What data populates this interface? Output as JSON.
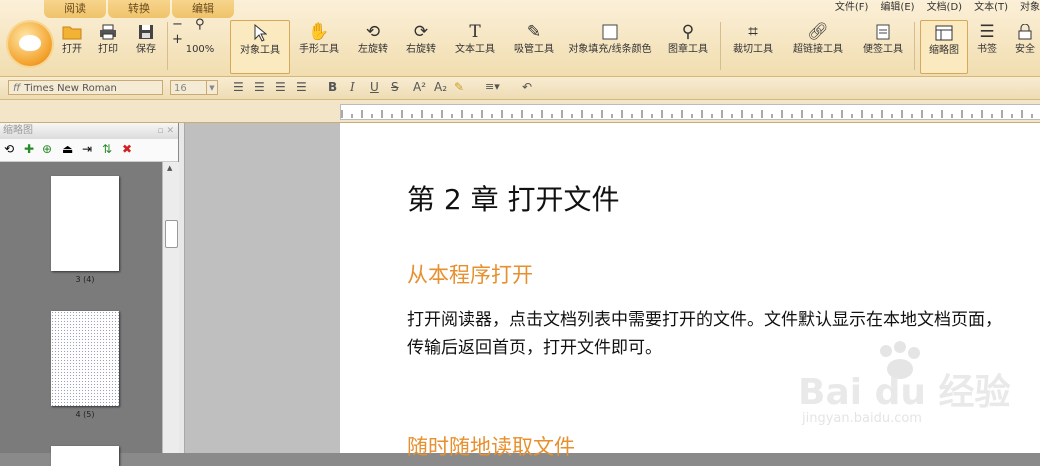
{
  "tabs": [
    "阅读",
    "转换",
    "编辑"
  ],
  "menubar": [
    "文件(F)",
    "编辑(E)",
    "文档(D)",
    "文本(T)",
    "对象"
  ],
  "toolbar": {
    "open": "打开",
    "print": "打印",
    "save": "保存",
    "zoom": "100%",
    "object_tool": "对象工具",
    "hand_tool": "手形工具",
    "rotate_left": "左旋转",
    "rotate_right": "右旋转",
    "text_tool": "文本工具",
    "eyedropper_tool": "吸管工具",
    "fill_tool": "对象填充/线条颜色",
    "stamp_tool": "图章工具",
    "crop_tool": "裁切工具",
    "link_tool": "超链接工具",
    "note_tool": "便签工具",
    "thumbnail": "缩略图",
    "bookmark": "书签",
    "security": "安全"
  },
  "format": {
    "font": "Times New Roman",
    "size": "16"
  },
  "panel": {
    "title": "缩略图",
    "thumbs": [
      {
        "label": "3 (4)"
      },
      {
        "label": "4 (5)"
      }
    ]
  },
  "doc": {
    "chapter": "第 2 章  打开文件",
    "section1": "从本程序打开",
    "para": "打开阅读器，点击文档列表中需要打开的文件。文件默认显示在本地文档页面，传输后返回首页，打开文件即可。",
    "section2": "随时随地读取文件"
  },
  "watermark": {
    "brand": "Bai du 经验",
    "url": "jingyan.baidu.com"
  },
  "colors": {
    "ribbon": "#f3dfb4",
    "heading_accent": "#e7902f"
  }
}
